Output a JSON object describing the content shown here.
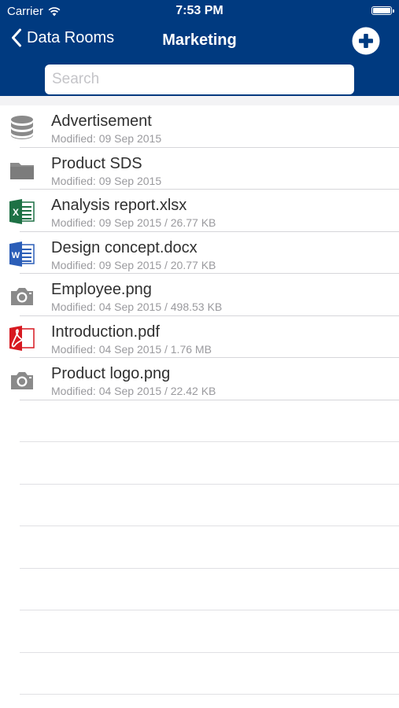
{
  "status_bar": {
    "carrier": "Carrier",
    "time": "7:53 PM"
  },
  "nav": {
    "back_label": "Data Rooms",
    "title": "Marketing"
  },
  "search": {
    "placeholder": "Search",
    "value": ""
  },
  "files": [
    {
      "name": "Advertisement",
      "meta": "Modified: 09 Sep 2015",
      "icon": "database-icon"
    },
    {
      "name": "Product SDS",
      "meta": "Modified: 09 Sep 2015",
      "icon": "folder-icon"
    },
    {
      "name": "Analysis report.xlsx",
      "meta": "Modified: 09 Sep 2015 / 26.77 KB",
      "icon": "excel-icon"
    },
    {
      "name": "Design concept.docx",
      "meta": "Modified: 09 Sep 2015 / 20.77 KB",
      "icon": "word-icon"
    },
    {
      "name": "Employee.png",
      "meta": "Modified: 04 Sep 2015 / 498.53 KB",
      "icon": "camera-icon"
    },
    {
      "name": "Introduction.pdf",
      "meta": "Modified: 04 Sep 2015 / 1.76 MB",
      "icon": "pdf-icon"
    },
    {
      "name": "Product logo.png",
      "meta": "Modified: 04 Sep 2015 / 22.42 KB",
      "icon": "camera-icon"
    }
  ],
  "colors": {
    "header_bg": "#003a80",
    "excel_green": "#1e7145",
    "word_blue": "#2b5eb8",
    "pdf_red": "#d71920",
    "icon_gray": "#8a8a8a"
  }
}
